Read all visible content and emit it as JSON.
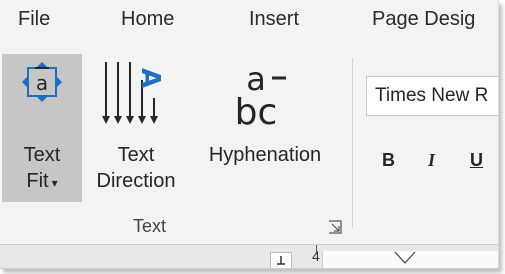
{
  "menu": {
    "items": [
      {
        "label": "File"
      },
      {
        "label": "Home"
      },
      {
        "label": "Insert"
      },
      {
        "label": "Page Desig"
      }
    ]
  },
  "text_group": {
    "text_fit": {
      "line1": "Text",
      "line2": "Fit",
      "icon": "text-fit-icon"
    },
    "text_direction": {
      "line1": "Text",
      "line2": "Direction",
      "icon": "text-direction-icon"
    },
    "hyphenation": {
      "label": "Hyphenation",
      "icon": "hyphenation-icon"
    },
    "group_label": "Text"
  },
  "font": {
    "font_name": "Times New R",
    "bold": "B",
    "italic": "I",
    "underline": "U"
  },
  "ruler": {
    "indicator": "4"
  },
  "colors": {
    "accent_blue": "#1f6fbf",
    "selected_bg": "#c6c6c6",
    "ribbon_bg": "#f3f3f3"
  }
}
